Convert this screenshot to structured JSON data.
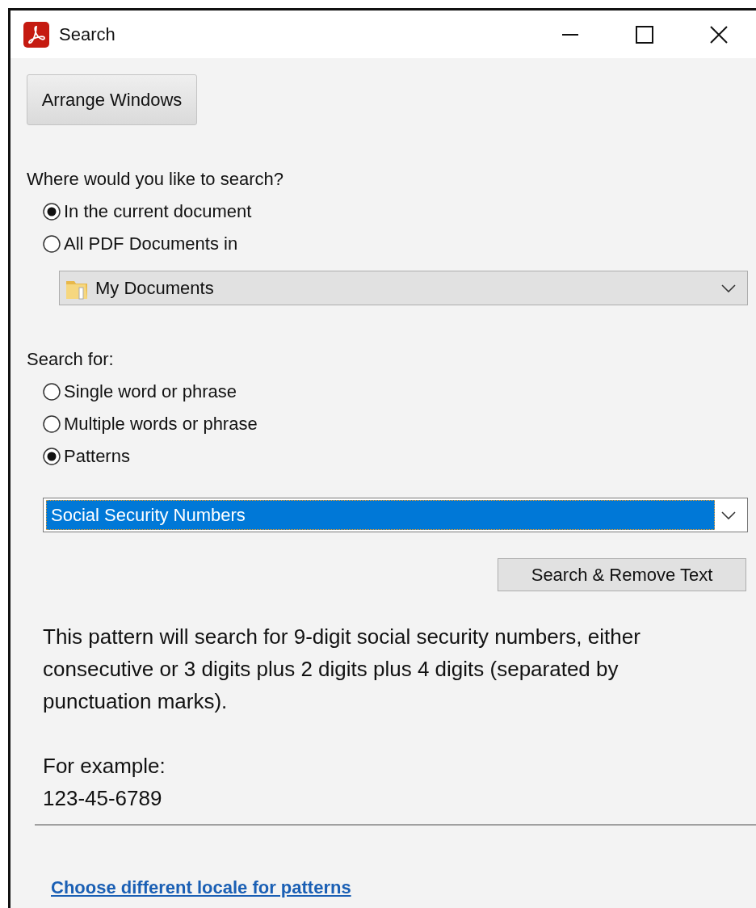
{
  "window": {
    "title": "Search"
  },
  "arrange_button": "Arrange Windows",
  "where": {
    "label": "Where would you like to search?",
    "options": [
      {
        "label": "In the current document",
        "selected": true
      },
      {
        "label": "All PDF Documents in",
        "selected": false
      }
    ],
    "folder": {
      "value": "My Documents"
    }
  },
  "search_for": {
    "label": "Search for:",
    "options": [
      {
        "label": "Single word or phrase",
        "selected": false
      },
      {
        "label": "Multiple words or phrase",
        "selected": false
      },
      {
        "label": "Patterns",
        "selected": true
      }
    ],
    "pattern": {
      "value": "Social Security Numbers"
    }
  },
  "search_button": "Search & Remove Text",
  "description": "This pattern will search for 9-digit social security numbers, either consecutive or 3 digits plus 2 digits plus 4 digits (separated by punctuation marks).",
  "example_label": "For example:",
  "example_value": "123-45-6789",
  "locale_link": "Choose different locale for patterns"
}
